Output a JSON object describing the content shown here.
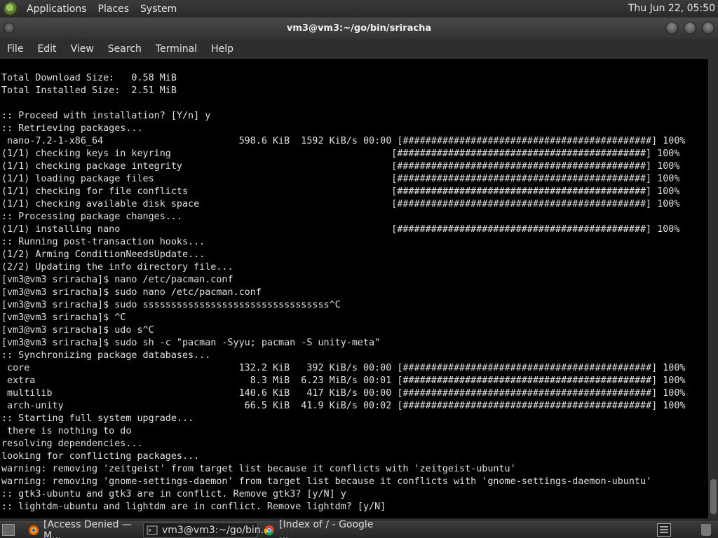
{
  "top_panel": {
    "menus": [
      "Applications",
      "Places",
      "System"
    ],
    "clock": "Thu Jun 22, 05:50"
  },
  "window": {
    "title": "vm3@vm3:~/go/bin/sriracha"
  },
  "menubar": [
    "File",
    "Edit",
    "View",
    "Search",
    "Terminal",
    "Help"
  ],
  "terminal": {
    "lines": [
      "Total Download Size:   0.58 MiB",
      "Total Installed Size:  2.51 MiB",
      "",
      ":: Proceed with installation? [Y/n] y",
      ":: Retrieving packages...",
      " nano-7.2-1-x86_64                        598.6 KiB  1592 KiB/s 00:00 [############################################] 100%",
      "(1/1) checking keys in keyring                                       [############################################] 100%",
      "(1/1) checking package integrity                                     [############################################] 100%",
      "(1/1) loading package files                                          [############################################] 100%",
      "(1/1) checking for file conflicts                                    [############################################] 100%",
      "(1/1) checking available disk space                                  [############################################] 100%",
      ":: Processing package changes...",
      "(1/1) installing nano                                                [############################################] 100%",
      ":: Running post-transaction hooks...",
      "(1/2) Arming ConditionNeedsUpdate...",
      "(2/2) Updating the info directory file...",
      "[vm3@vm3 sriracha]$ nano /etc/pacman.conf",
      "[vm3@vm3 sriracha]$ sudo nano /etc/pacman.conf",
      "[vm3@vm3 sriracha]$ sudo sssssssssssssssssssssssssssssssss^C",
      "[vm3@vm3 sriracha]$ ^C",
      "[vm3@vm3 sriracha]$ udo s^C",
      "[vm3@vm3 sriracha]$ sudo sh -c \"pacman -Syyu; pacman -S unity-meta\"",
      ":: Synchronizing package databases...",
      " core                                     132.2 KiB   392 KiB/s 00:00 [############################################] 100%",
      " extra                                      8.3 MiB  6.23 MiB/s 00:01 [############################################] 100%",
      " multilib                                 140.6 KiB   417 KiB/s 00:00 [############################################] 100%",
      " arch-unity                                66.5 KiB  41.9 KiB/s 00:02 [############################################] 100%",
      ":: Starting full system upgrade...",
      " there is nothing to do",
      "resolving dependencies...",
      "looking for conflicting packages...",
      "warning: removing 'zeitgeist' from target list because it conflicts with 'zeitgeist-ubuntu'",
      "warning: removing 'gnome-settings-daemon' from target list because it conflicts with 'gnome-settings-daemon-ubuntu'",
      ":: gtk3-ubuntu and gtk3 are in conflict. Remove gtk3? [y/N] y",
      ":: lightdm-ubuntu and lightdm are in conflict. Remove lightdm? [y/N]"
    ]
  },
  "taskbar": {
    "tasks": [
      {
        "label": "[Access Denied — M...",
        "icon": "firefox-icon"
      },
      {
        "label": "vm3@vm3:~/go/bin...",
        "icon": "terminal-icon"
      },
      {
        "label": "[Index of / - Google ...",
        "icon": "chrome-icon"
      }
    ]
  }
}
